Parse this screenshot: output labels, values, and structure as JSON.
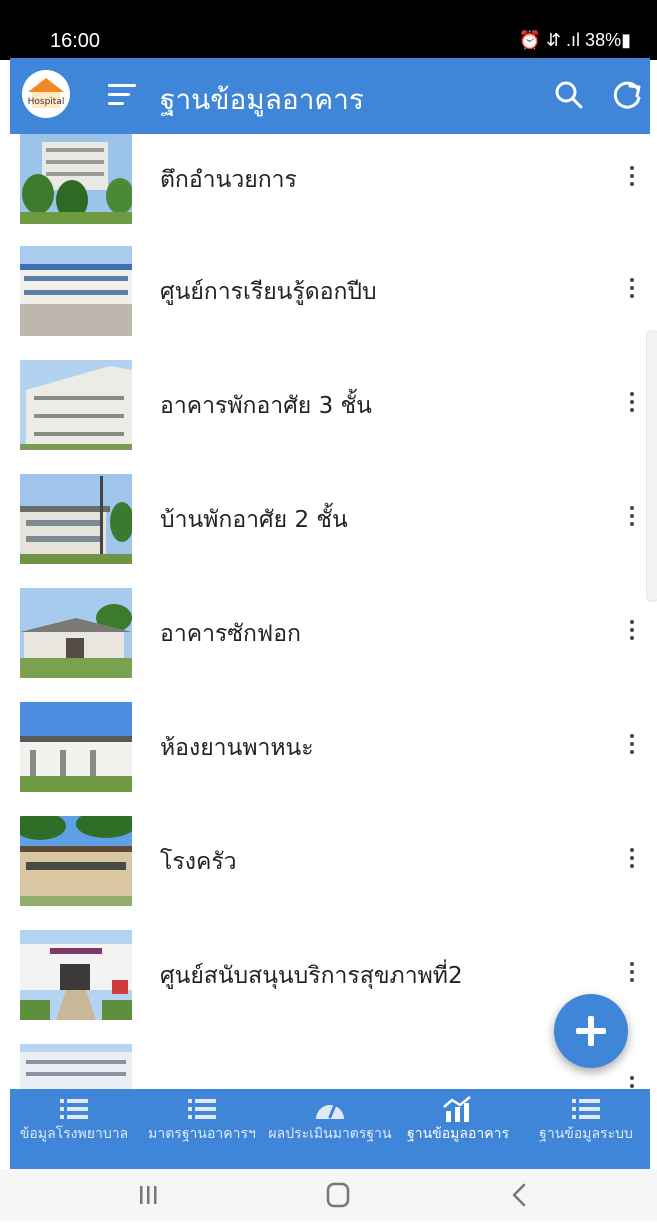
{
  "status_bar": {
    "time": "16:00",
    "indicators": "⏰ ⇵ .ıl 38%▮"
  },
  "app_bar": {
    "title": "ฐานข้อมูลอาคาร",
    "logo_text": "Hospital"
  },
  "items": [
    {
      "title": "ตึกอำนวยการ"
    },
    {
      "title": "ศูนย์การเรียนรู้ดอกปีบ"
    },
    {
      "title": "อาคารพักอาศัย 3 ชั้น"
    },
    {
      "title": "บ้านพักอาศัย 2 ชั้น"
    },
    {
      "title": "อาคารซักฟอก"
    },
    {
      "title": "ห้องยานพาหนะ"
    },
    {
      "title": "โรงครัว"
    },
    {
      "title": "ศูนย์สนับสนุนบริการสุขภาพที่2"
    },
    {
      "title": ""
    }
  ],
  "bottom_nav": [
    {
      "label": "ข้อมูลโรงพยาบาล",
      "icon": "list-icon"
    },
    {
      "label": "มาตรฐานอาคารฯ",
      "icon": "list-icon"
    },
    {
      "label": "ผลประเมินมาตรฐาน",
      "icon": "gauge-icon"
    },
    {
      "label": "ฐานข้อมูลอาคาร",
      "icon": "building-chart-icon",
      "active": true
    },
    {
      "label": "ฐานข้อมูลระบบ",
      "icon": "list-icon"
    }
  ],
  "colors": {
    "primary": "#3f85d8",
    "status_bar": "#000000",
    "nav_bar": "#f6f6f6"
  }
}
